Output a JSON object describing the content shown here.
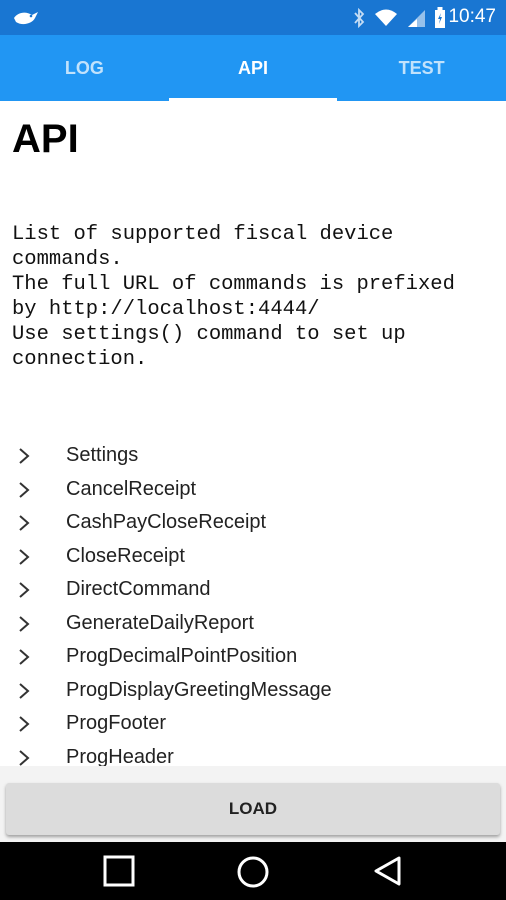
{
  "status_bar": {
    "time": "10:47",
    "icons": [
      "app-bird-icon",
      "bluetooth-icon",
      "wifi-icon",
      "signal-icon",
      "battery-icon"
    ]
  },
  "tabs": [
    {
      "label": "LOG",
      "active": false
    },
    {
      "label": "API",
      "active": true
    },
    {
      "label": "TEST",
      "active": false
    }
  ],
  "page": {
    "title": "API",
    "description": "List of supported fiscal device\ncommands.\nThe full URL of commands is prefixed\nby http://localhost:4444/\nUse settings() command to set up\nconnection."
  },
  "commands": [
    "Settings",
    "CancelReceipt",
    "CashPayCloseReceipt",
    "CloseReceipt",
    "DirectCommand",
    "GenerateDailyReport",
    "ProgDecimalPointPosition",
    "ProgDisplayGreetingMessage",
    "ProgFooter",
    "ProgHeader"
  ],
  "load_button": {
    "label": "LOAD"
  },
  "nav_bar": {
    "buttons": [
      "recents-icon",
      "home-icon",
      "back-icon"
    ]
  },
  "colors": {
    "status_bar": "#1976d2",
    "tab_bar": "#2196f3",
    "tab_indicator": "#ffffff"
  }
}
